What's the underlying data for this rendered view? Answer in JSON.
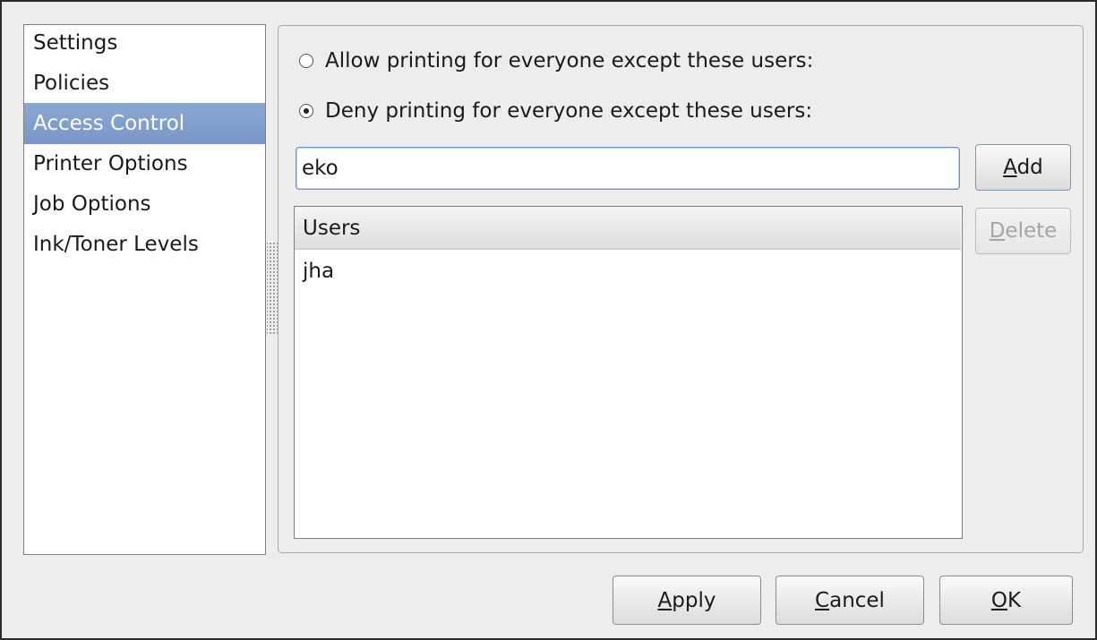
{
  "sidebar": {
    "items": [
      {
        "label": "Settings",
        "selected": false
      },
      {
        "label": "Policies",
        "selected": false
      },
      {
        "label": "Access Control",
        "selected": true
      },
      {
        "label": "Printer Options",
        "selected": false
      },
      {
        "label": "Job Options",
        "selected": false
      },
      {
        "label": "Ink/Toner Levels",
        "selected": false
      }
    ]
  },
  "access_control": {
    "allow_label": "Allow printing for everyone except these users:",
    "allow_selected": false,
    "deny_label": "Deny printing for everyone except these users:",
    "deny_selected": true,
    "user_input_value": "eko",
    "add_label": "Add",
    "add_mnemonic": "A",
    "add_rest": "dd",
    "delete_label": "Delete",
    "delete_mnemonic": "D",
    "delete_rest": "elete",
    "delete_enabled": false,
    "users_header": "Users",
    "users": [
      "jha"
    ]
  },
  "footer": {
    "apply_label": "Apply",
    "apply_mnemonic": "A",
    "apply_rest": "pply",
    "cancel_label": "Cancel",
    "cancel_mnemonic": "C",
    "cancel_rest": "ancel",
    "ok_label": "OK",
    "ok_mnemonic": "O",
    "ok_rest": "K"
  },
  "colors": {
    "selection": "#7f9ccb",
    "input_focus_border": "#6f8fc4",
    "disabled_text": "#a5a5a5"
  }
}
